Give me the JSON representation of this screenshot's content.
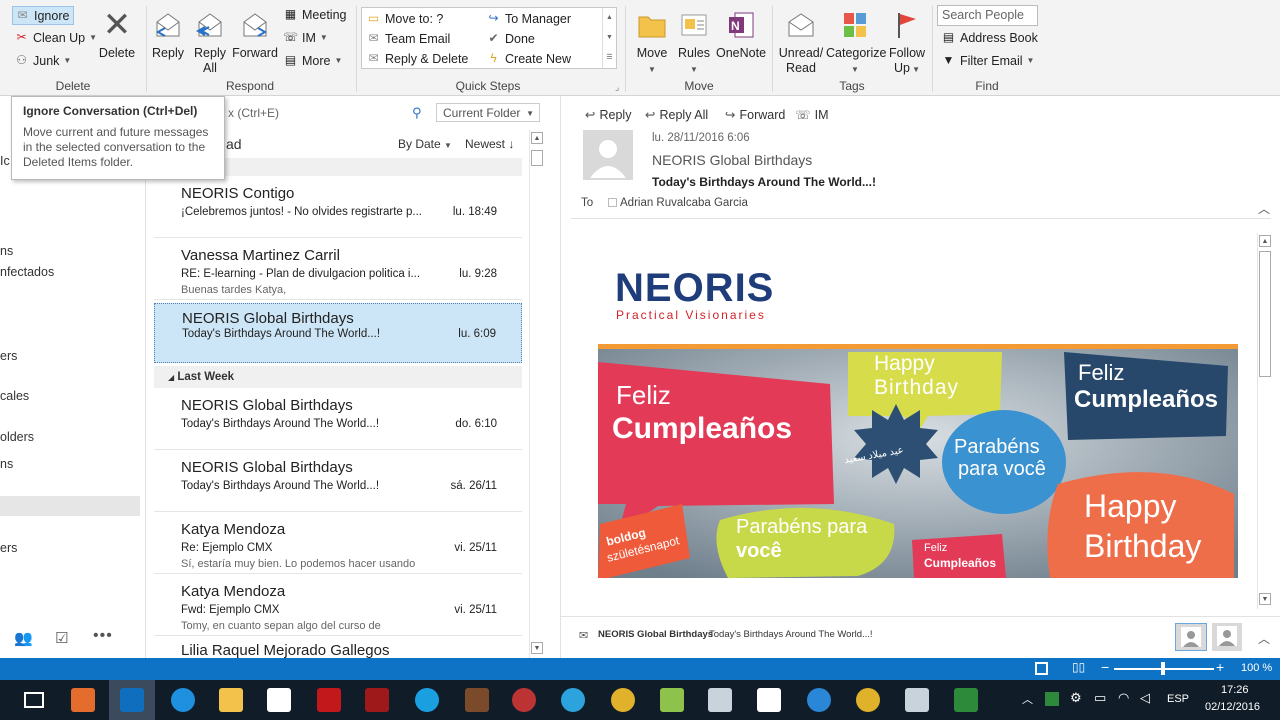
{
  "ribbon": {
    "delete_group": {
      "ignore": "Ignore",
      "cleanup": "Clean Up",
      "junk": "Junk",
      "delete": "Delete",
      "label": "Delete"
    },
    "respond_group": {
      "reply": "Reply",
      "reply_all_1": "Reply",
      "reply_all_2": "All",
      "forward": "Forward",
      "meeting": "Meeting",
      "im": "IM",
      "more": "More",
      "label": "Respond"
    },
    "quicksteps": {
      "move_to": "Move to: ?",
      "team_email": "Team Email",
      "reply_delete": "Reply & Delete",
      "to_manager": "To Manager",
      "done": "Done",
      "create_new": "Create New",
      "label": "Quick Steps"
    },
    "move_group": {
      "move": "Move",
      "rules": "Rules",
      "onenote": "OneNote",
      "label": "Move"
    },
    "tags_group": {
      "unread_1": "Unread/",
      "unread_2": "Read",
      "categorize": "Categorize",
      "follow_1": "Follow",
      "follow_2": "Up",
      "label": "Tags"
    },
    "find_group": {
      "search_people": "Search People",
      "address_book": "Address Book",
      "filter_email": "Filter Email",
      "label": "Find"
    }
  },
  "tooltip": {
    "title": "Ignore Conversation (Ctrl+Del)",
    "body": "Move current and future messages in the selected conversation to the Deleted Items folder."
  },
  "nav": {
    "items": [
      "Ic",
      "ns",
      "nfectados",
      "ers",
      "cales",
      "olders",
      "ns",
      "ers"
    ]
  },
  "list": {
    "search_placeholder": "x (Ctrl+E)",
    "folder_scope": "Current Folder",
    "filter_label": "ad",
    "sort": "By Date",
    "order": "Newest",
    "group_last_week": "Last Week",
    "messages": [
      {
        "from": "NEORIS Contigo",
        "subject": "¡Celebremos juntos! - No olvides registrarte p...",
        "preview": "",
        "date": "lu. 18:49"
      },
      {
        "from": "Vanessa Martinez Carril",
        "subject": "RE: E-learning - Plan de divulgacion politica i...",
        "preview": "Buenas tardes Katya,",
        "date": "lu. 9:28"
      },
      {
        "from": "NEORIS Global Birthdays",
        "subject": "Today's Birthdays Around The World...!",
        "preview": "",
        "date": "lu. 6:09"
      },
      {
        "from": "NEORIS Global Birthdays",
        "subject": "Today's Birthdays Around The World...!",
        "preview": "",
        "date": "do. 6:10"
      },
      {
        "from": "NEORIS Global Birthdays",
        "subject": "Today's Birthdays Around The World...!",
        "preview": "",
        "date": "sá. 26/11"
      },
      {
        "from": "Katya Mendoza",
        "subject": "Re: Ejemplo CMX",
        "preview": "Sí, estaría muy bien. Lo podemos hacer usando",
        "date": "vi. 25/11"
      },
      {
        "from": "Katya Mendoza",
        "subject": "Fwd: Ejemplo CMX",
        "preview": "Tomy, en cuanto sepan algo del curso de",
        "date": "vi. 25/11"
      },
      {
        "from": "Lilia Raquel Mejorado Gallegos",
        "subject": "",
        "preview": "",
        "date": ""
      }
    ]
  },
  "reading": {
    "actions": {
      "reply": "Reply",
      "reply_all": "Reply All",
      "forward": "Forward",
      "im": "IM"
    },
    "date": "lu. 28/11/2016 6:06",
    "sender": "NEORIS Global Birthdays",
    "subject": "Today's Birthdays Around The World...!",
    "to_label": "To",
    "to": "Adrian Ruvalcaba Garcia",
    "logo": "NEORIS",
    "tagline": "Practical Visionaries",
    "bubbles": [
      "Feliz",
      "Cumpleaños",
      "Happy",
      "Birthday",
      "Feliz",
      "Cumpleaños",
      "Parabéns",
      "para você",
      "Parabéns para",
      "você",
      "Happy",
      "Birthday",
      "boldog",
      "születésnapot",
      "Feliz",
      "Cumpleaños",
      "عيد ميلاد سعيد"
    ],
    "people_pane": "NEORIS Global Birthdays",
    "people_pane_sub": "Today's Birthdays Around The World...!"
  },
  "statusbar": {
    "zoom": "100 %"
  },
  "taskbar": {
    "lang": "ESP",
    "time": "17:26",
    "date": "02/12/2016"
  },
  "colors": {
    "accent": "#0e72c5",
    "selection": "#cde6f7",
    "neoris_blue": "#1e3d7a",
    "neoris_red": "#d2232a"
  }
}
